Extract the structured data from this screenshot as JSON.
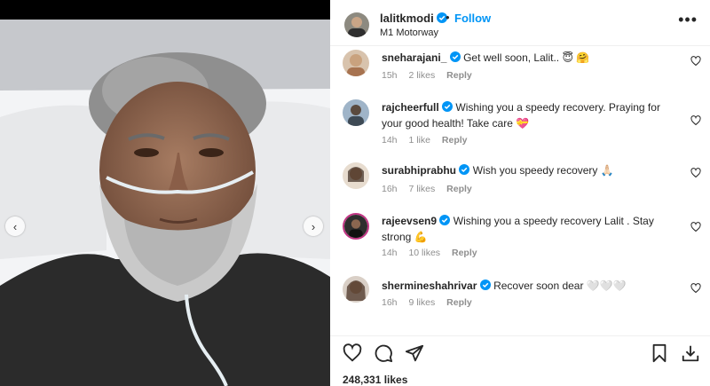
{
  "header": {
    "username": "lalitkmodi",
    "separator": "•",
    "follow_label": "Follow",
    "location": "M1 Motorway"
  },
  "comments": [
    {
      "username": "sneharajani_",
      "verified": true,
      "text": "Get well soon, Lalit.. 😇 🤗",
      "time": "15h",
      "likes": "2 likes",
      "reply": "Reply",
      "avatar_color": "#c9a27e"
    },
    {
      "username": "rajcheerfull",
      "verified": true,
      "text": "Wishing you a speedy recovery. Praying for your good health! Take care 💝",
      "time": "14h",
      "likes": "1 like",
      "reply": "Reply",
      "avatar_color": "#6b8aa8"
    },
    {
      "username": "surabhiprabhu",
      "verified": true,
      "text": "Wish you speedy recovery 🙏🏻",
      "time": "16h",
      "likes": "7 likes",
      "reply": "Reply",
      "avatar_color": "#b48a6a"
    },
    {
      "username": "rajeevsen9",
      "verified": true,
      "text": "Wishing you a speedy recovery Lalit . Stay strong 💪",
      "time": "14h",
      "likes": "10 likes",
      "reply": "Reply",
      "avatar_color": "#3a3a3a"
    },
    {
      "username": "shermineshahrivar",
      "verified": true,
      "text": "Recover soon dear 🤍🤍🤍",
      "time": "16h",
      "likes": "9 likes",
      "reply": "Reply",
      "avatar_color": "#8b6b55"
    }
  ],
  "likes_count": "248,331 likes",
  "icons": {
    "like": "heart-icon",
    "comment": "comment-icon",
    "share": "share-icon",
    "save": "bookmark-icon",
    "download": "download-icon",
    "more": "more-icon",
    "prev": "chevron-left-icon",
    "next": "chevron-right-icon"
  },
  "colors": {
    "accent": "#0095f6",
    "verified": "#0095f6",
    "muted": "#8e8e8e"
  }
}
